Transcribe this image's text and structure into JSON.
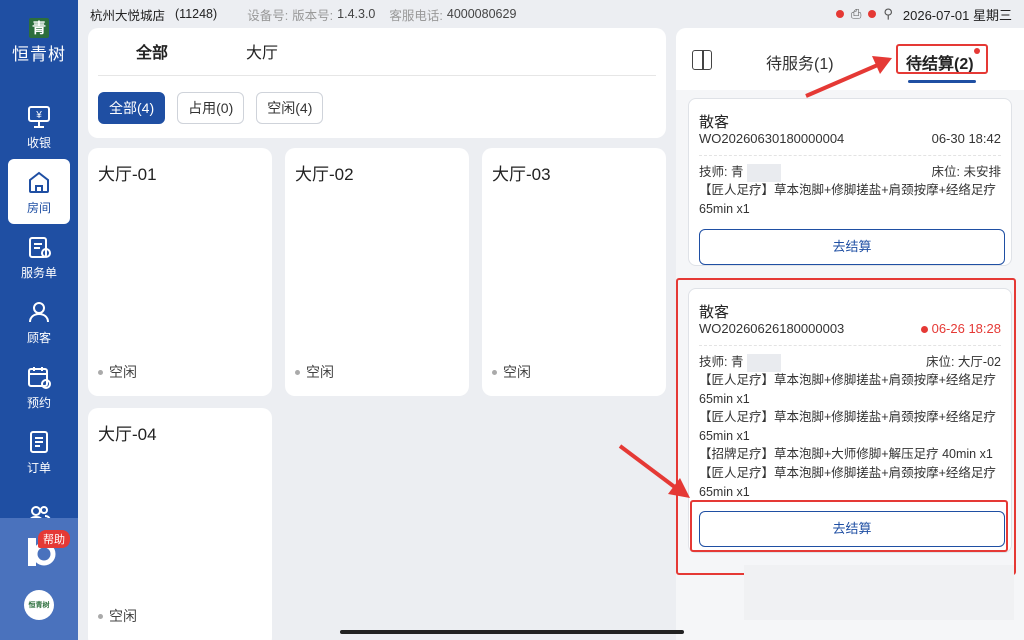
{
  "sidebar": {
    "logo_mark": "青",
    "logo_text": "恒青树",
    "items": [
      {
        "label": "收银",
        "icon": "cashier-icon"
      },
      {
        "label": "房间",
        "icon": "home-icon",
        "active": true
      },
      {
        "label": "服务单",
        "icon": "service-order-icon"
      },
      {
        "label": "顾客",
        "icon": "customer-icon"
      },
      {
        "label": "预约",
        "icon": "calendar-icon"
      },
      {
        "label": "订单",
        "icon": "order-icon"
      },
      {
        "label": "",
        "icon": "staff-icon"
      }
    ],
    "help_badge": "帮助",
    "avatar_text": "恒青树"
  },
  "topbar": {
    "store": "杭州大悦城店",
    "store_id": "(11248)",
    "device_label": "设备号:",
    "version_label": "版本号:",
    "version": "1.4.3.0",
    "phone_label": "客服电话:",
    "phone": "4000080629",
    "datetime": "2026-07-01 星期三"
  },
  "filter": {
    "tabs": [
      "全部",
      "大厅"
    ],
    "chips": [
      {
        "label": "全部(4)",
        "active": true
      },
      {
        "label": "占用(0)",
        "active": false
      },
      {
        "label": "空闲(4)",
        "active": false
      }
    ]
  },
  "rooms": [
    {
      "name": "大厅-01",
      "status": "空闲"
    },
    {
      "name": "大厅-02",
      "status": "空闲"
    },
    {
      "name": "大厅-03",
      "status": "空闲"
    },
    {
      "name": "大厅-04",
      "status": "空闲"
    }
  ],
  "panel": {
    "tab_pending_service": "待服务(1)",
    "tab_pending_checkout": "待结算(2)",
    "orders": [
      {
        "customer": "散客",
        "number": "WO20260630180000004",
        "time": "06-30 18:42",
        "late": false,
        "tech_label": "技师:",
        "tech": "青",
        "bed_label": "床位:",
        "bed": "未安排",
        "items": [
          "【匠人足疗】草本泡脚+修脚搓盐+肩颈按摩+经络足疗 65min x1"
        ],
        "button": "去结算"
      },
      {
        "customer": "散客",
        "number": "WO20260626180000003",
        "time": "06-26 18:28",
        "late": true,
        "tech_label": "技师:",
        "tech": "青",
        "bed_label": "床位:",
        "bed": "大厅-02",
        "items": [
          "【匠人足疗】草本泡脚+修脚搓盐+肩颈按摩+经络足疗 65min x1",
          "【匠人足疗】草本泡脚+修脚搓盐+肩颈按摩+经络足疗 65min x1",
          "【招牌足疗】草本泡脚+大师修脚+解压足疗 40min x1",
          "【匠人足疗】草本泡脚+修脚搓盐+肩颈按摩+经络足疗 65min x1"
        ],
        "button": "去结算"
      }
    ]
  },
  "colors": {
    "brand": "#1f4fa3",
    "alert": "#e53935"
  }
}
